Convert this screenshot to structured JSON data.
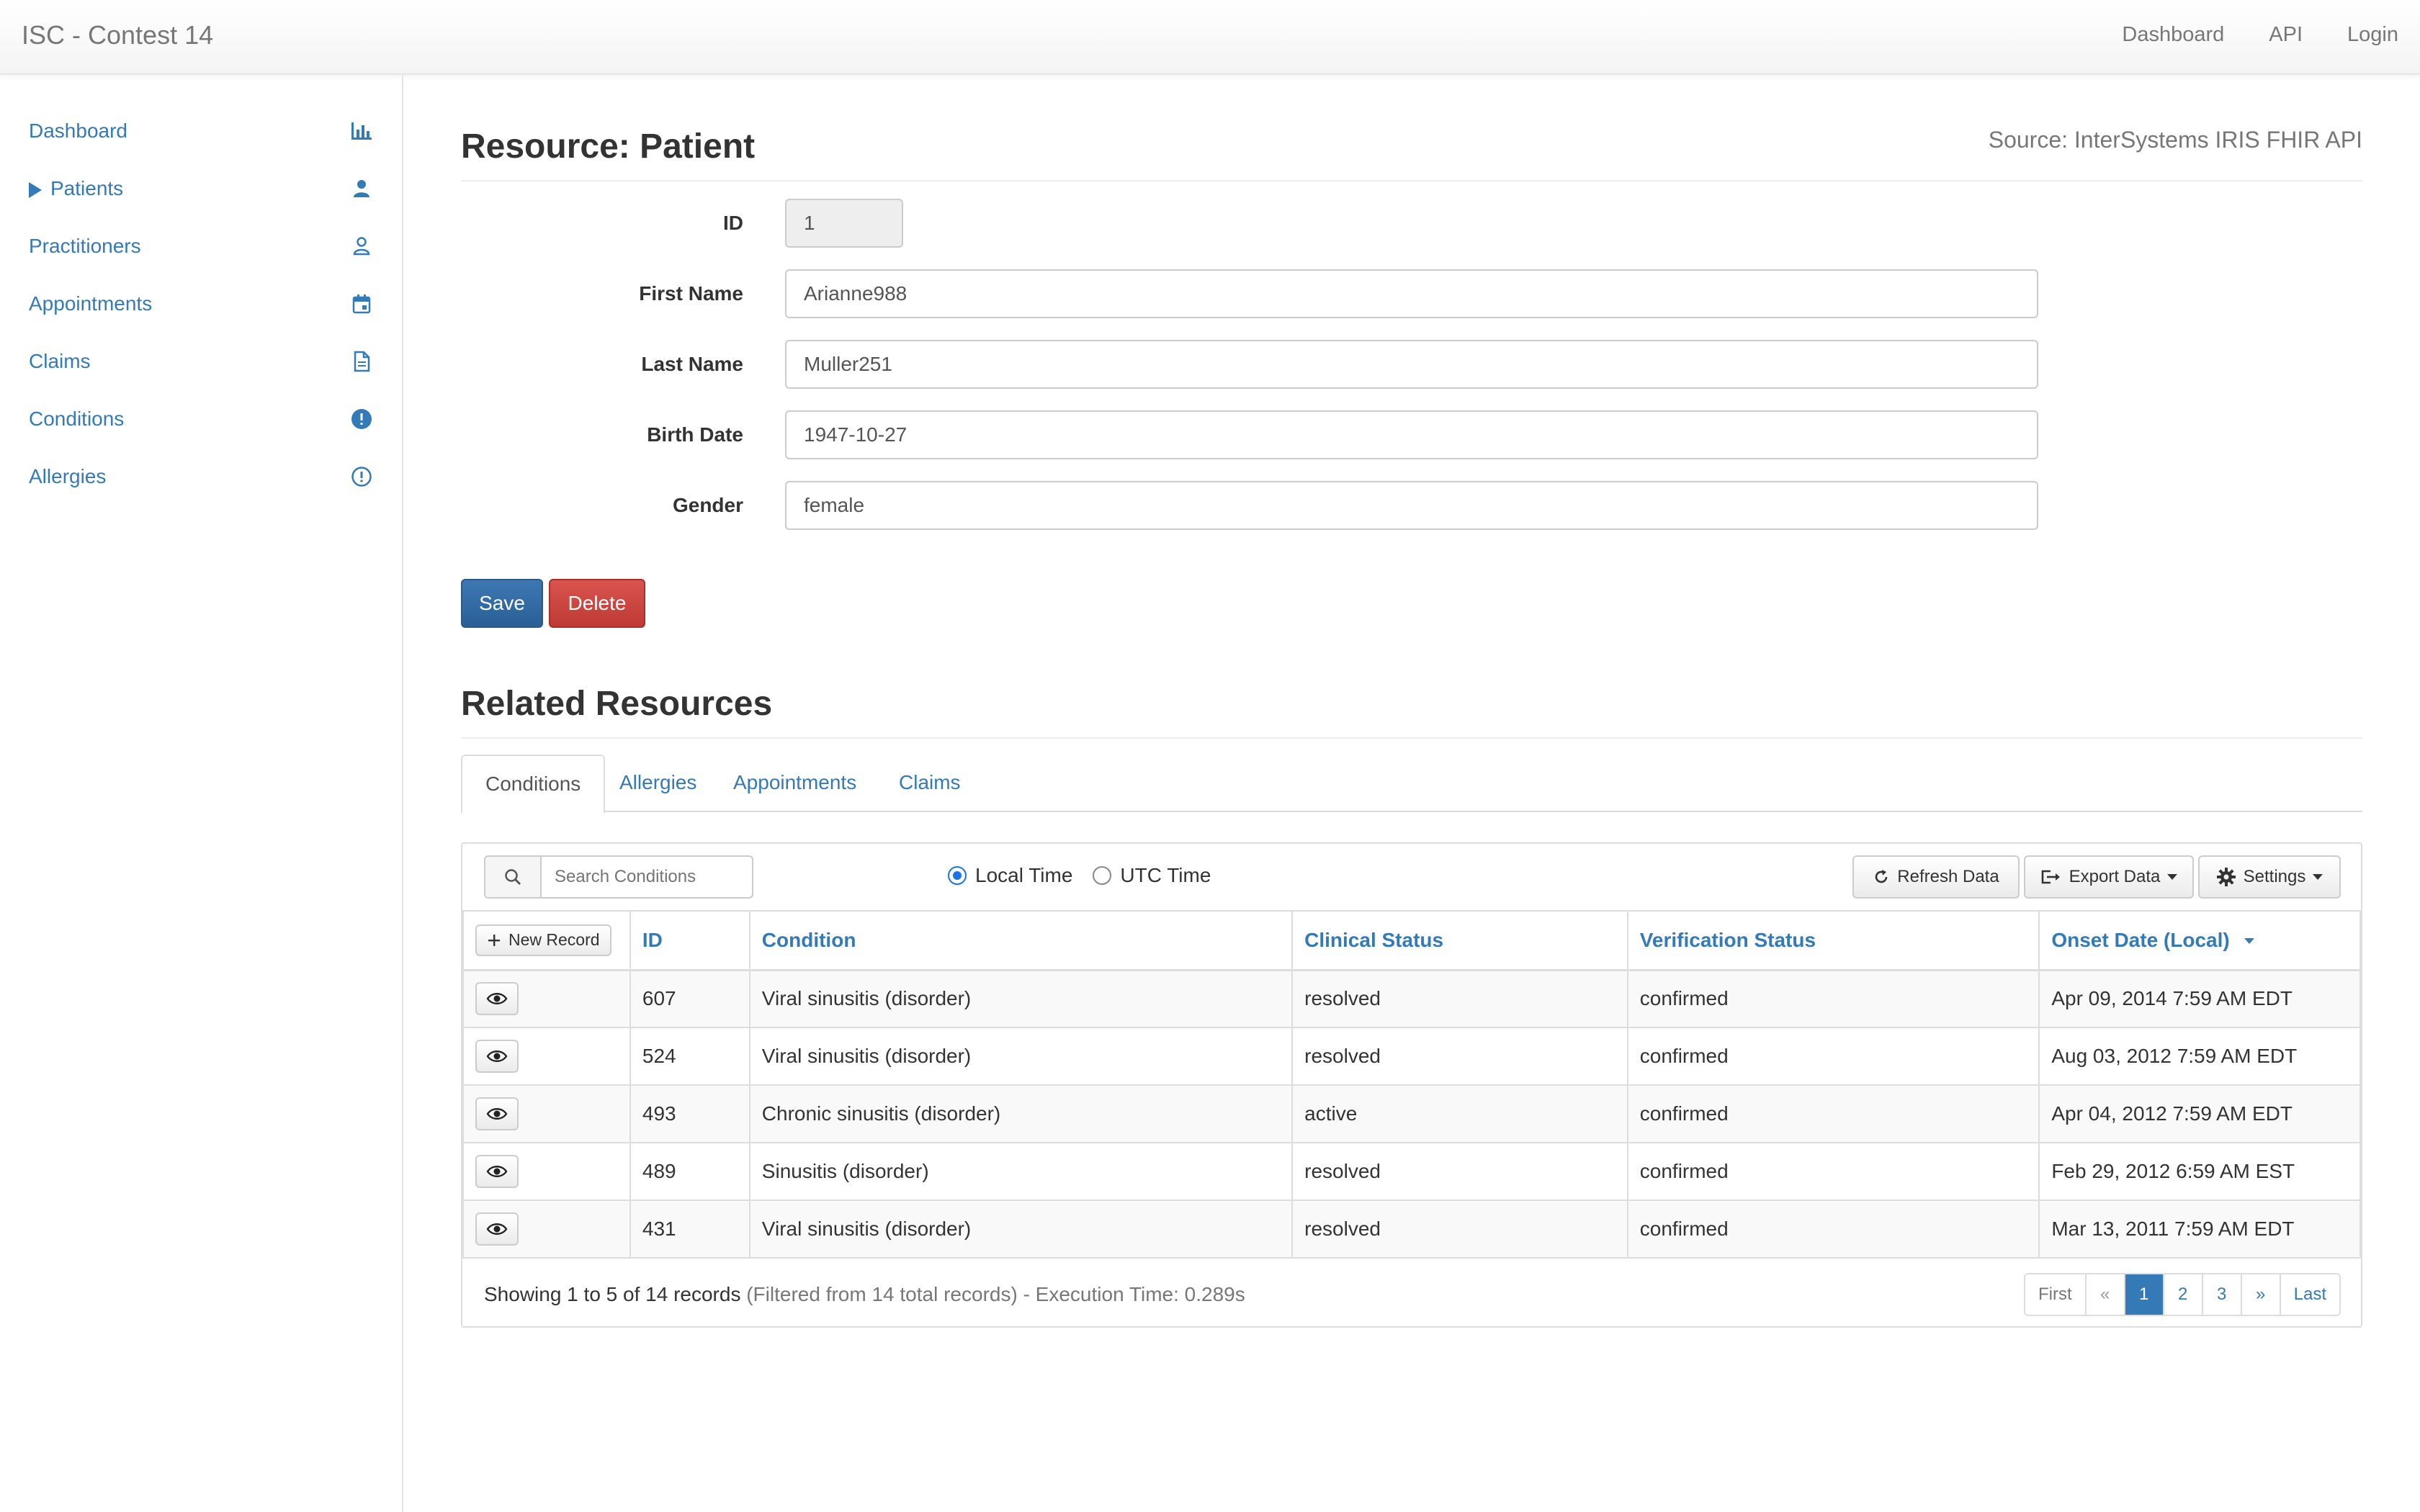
{
  "navbar": {
    "brand": "ISC - Contest 14",
    "links": [
      "Dashboard",
      "API",
      "Login"
    ]
  },
  "sidebar": {
    "items": [
      {
        "label": "Dashboard",
        "icon": "bar-chart-icon"
      },
      {
        "label": "Patients",
        "icon": "person-icon",
        "expanded_caret": true
      },
      {
        "label": "Practitioners",
        "icon": "person-outline-icon"
      },
      {
        "label": "Appointments",
        "icon": "calendar-icon"
      },
      {
        "label": "Claims",
        "icon": "document-icon"
      },
      {
        "label": "Conditions",
        "icon": "alert-filled-icon"
      },
      {
        "label": "Allergies",
        "icon": "alert-outline-icon"
      }
    ]
  },
  "resource": {
    "title": "Resource: Patient",
    "source": "Source: InterSystems IRIS FHIR API"
  },
  "form": {
    "id_label": "ID",
    "id_value": "1",
    "first_name_label": "First Name",
    "first_name_value": "Arianne988",
    "last_name_label": "Last Name",
    "last_name_value": "Muller251",
    "birth_date_label": "Birth Date",
    "birth_date_value": "1947-10-27",
    "gender_label": "Gender",
    "gender_value": "female",
    "save_label": "Save",
    "delete_label": "Delete"
  },
  "related": {
    "title": "Related Resources",
    "tabs": [
      "Conditions",
      "Allergies",
      "Appointments",
      "Claims"
    ],
    "active_tab": "Conditions"
  },
  "toolbar": {
    "search_placeholder": "Search Conditions",
    "local_time": "Local Time",
    "utc_time": "UTC Time",
    "time_mode": "Local Time",
    "refresh_label": "Refresh Data",
    "export_label": "Export Data",
    "settings_label": "Settings"
  },
  "table": {
    "new_record_label": "New Record",
    "columns": [
      "ID",
      "Condition",
      "Clinical Status",
      "Verification Status",
      "Onset Date (Local)"
    ],
    "rows": [
      {
        "id": "607",
        "condition": "Viral sinusitis (disorder)",
        "clinical": "resolved",
        "verification": "confirmed",
        "onset": "Apr 09, 2014 7:59 AM EDT"
      },
      {
        "id": "524",
        "condition": "Viral sinusitis (disorder)",
        "clinical": "resolved",
        "verification": "confirmed",
        "onset": "Aug 03, 2012 7:59 AM EDT"
      },
      {
        "id": "493",
        "condition": "Chronic sinusitis (disorder)",
        "clinical": "active",
        "verification": "confirmed",
        "onset": "Apr 04, 2012 7:59 AM EDT"
      },
      {
        "id": "489",
        "condition": "Sinusitis (disorder)",
        "clinical": "resolved",
        "verification": "confirmed",
        "onset": "Feb 29, 2012 6:59 AM EST"
      },
      {
        "id": "431",
        "condition": "Viral sinusitis (disorder)",
        "clinical": "resolved",
        "verification": "confirmed",
        "onset": "Mar 13, 2011 7:59 AM EDT"
      }
    ]
  },
  "footer": {
    "showing": "Showing 1 to 5 of 14 records",
    "filtered": "(Filtered from 14 total records) - Execution Time: 0.289s"
  },
  "pagination": {
    "first": "First",
    "prev": "«",
    "pages": [
      "1",
      "2",
      "3"
    ],
    "current": "1",
    "next": "»",
    "last": "Last"
  },
  "colors": {
    "link": "#337ab7",
    "save": "#2e6da4",
    "delete": "#d9534f"
  }
}
